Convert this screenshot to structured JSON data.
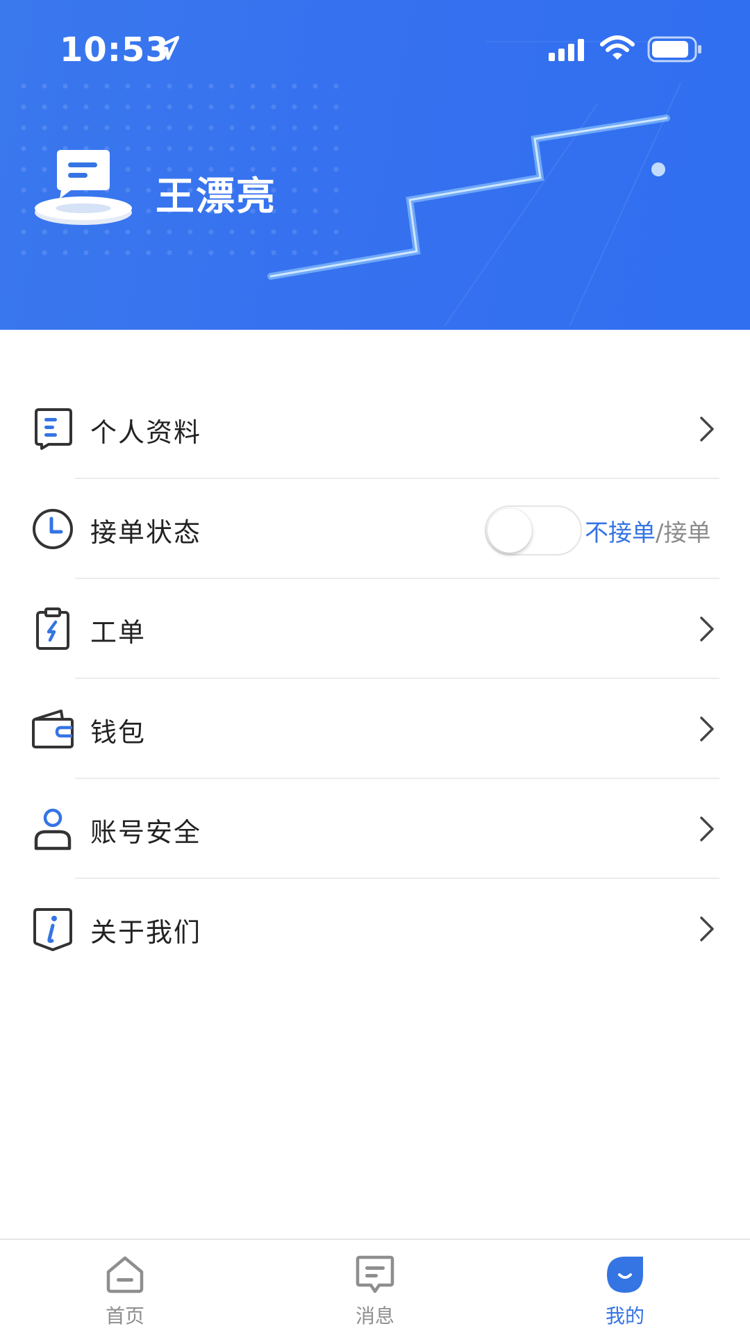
{
  "status_bar": {
    "time": "10:53",
    "icons": [
      "location-arrow-icon",
      "signal-icon",
      "wifi-icon",
      "battery-icon"
    ]
  },
  "profile": {
    "name": "王漂亮",
    "avatar_icon": "chat-avatar-icon"
  },
  "menu": {
    "items": [
      {
        "label": "个人资料",
        "icon": "profile-card-icon"
      },
      {
        "label": "接单状态",
        "icon": "clock-icon"
      },
      {
        "label": "工单",
        "icon": "work-order-icon"
      },
      {
        "label": "钱包",
        "icon": "wallet-icon"
      },
      {
        "label": "账号安全",
        "icon": "user-icon"
      },
      {
        "label": "关于我们",
        "icon": "info-icon"
      }
    ],
    "order_status": {
      "off_label": "不接单",
      "separator": "/",
      "on_label": "接单",
      "enabled": false
    }
  },
  "tabbar": {
    "tabs": [
      {
        "label": "首页",
        "icon": "home-icon",
        "active": false
      },
      {
        "label": "消息",
        "icon": "message-icon",
        "active": false
      },
      {
        "label": "我的",
        "icon": "mine-icon",
        "active": true
      }
    ]
  },
  "colors": {
    "header_blue": "#3570ef",
    "accent": "#3574e3",
    "text": "#222222",
    "muted": "#8e8e8e"
  }
}
